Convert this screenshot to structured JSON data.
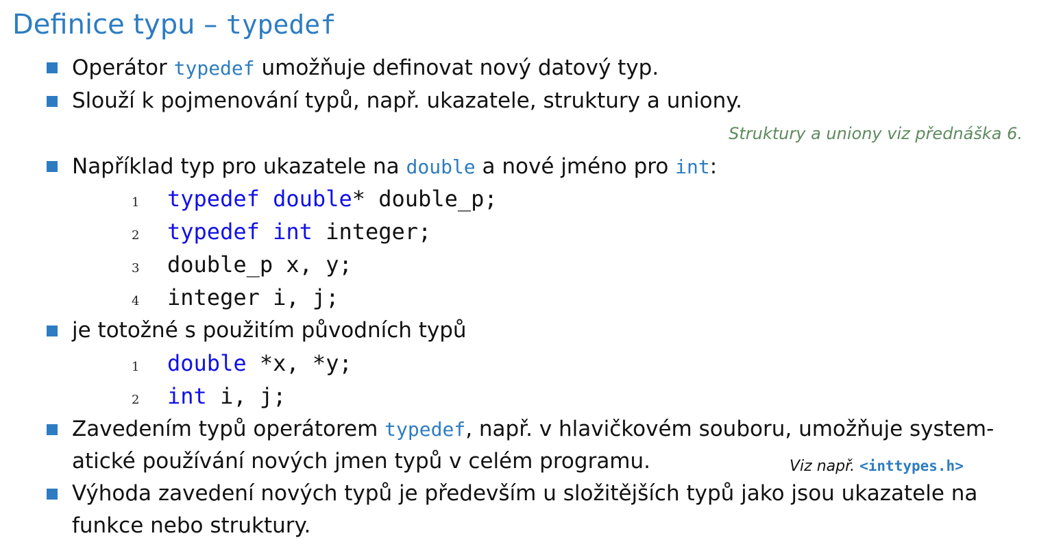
{
  "title": {
    "text": "Definice typu –",
    "code": "typedef"
  },
  "note_structures": "Struktury a uniony viz přednáška 6.",
  "bullets": {
    "b1": {
      "before": "Operátor",
      "kw": "typedef",
      "after": "umožňuje definovat nový datový typ."
    },
    "b2": {
      "text": "Slouží k pojmenování typů, např. ukazatele, struktury a uniony."
    },
    "b3": {
      "before": "Například typ pro ukazatele na",
      "kw1": "double",
      "middle": "a nové jméno pro",
      "kw2": "int",
      "after": ":"
    },
    "b4": {
      "text": "je totožné s použitím původních typů"
    },
    "b5": {
      "before": "Zavedením typů operátorem",
      "kw": "typedef",
      "after": ", např. v hlavičkovém souboru, umožňuje system-",
      "line2": "atické používání nových jmen typů v celém programu."
    },
    "b6": {
      "line1": "Výhoda zavedení nových typů je především u složitějších typů jako jsou ukazatele na",
      "line2": "funkce nebo struktury."
    }
  },
  "code_block_1": [
    {
      "num": "1",
      "kw": "typedef double",
      "rest": "* double_p;"
    },
    {
      "num": "2",
      "kw": "typedef int",
      "rest": " integer;"
    },
    {
      "num": "3",
      "kw": "",
      "rest": "double_p x, y;"
    },
    {
      "num": "4",
      "kw": "",
      "rest": "integer i, j;"
    }
  ],
  "code_block_2": [
    {
      "num": "1",
      "kw": "double",
      "rest": " *x, *y;"
    },
    {
      "num": "2",
      "kw": "int",
      "rest": " i, j;"
    }
  ],
  "see_note": {
    "label": "Viz např.",
    "header": "<inttypes.h>"
  },
  "colors": {
    "accent": "#2d7cc1",
    "code_keyword": "#1111e6",
    "note_green": "#5e8a5f"
  }
}
